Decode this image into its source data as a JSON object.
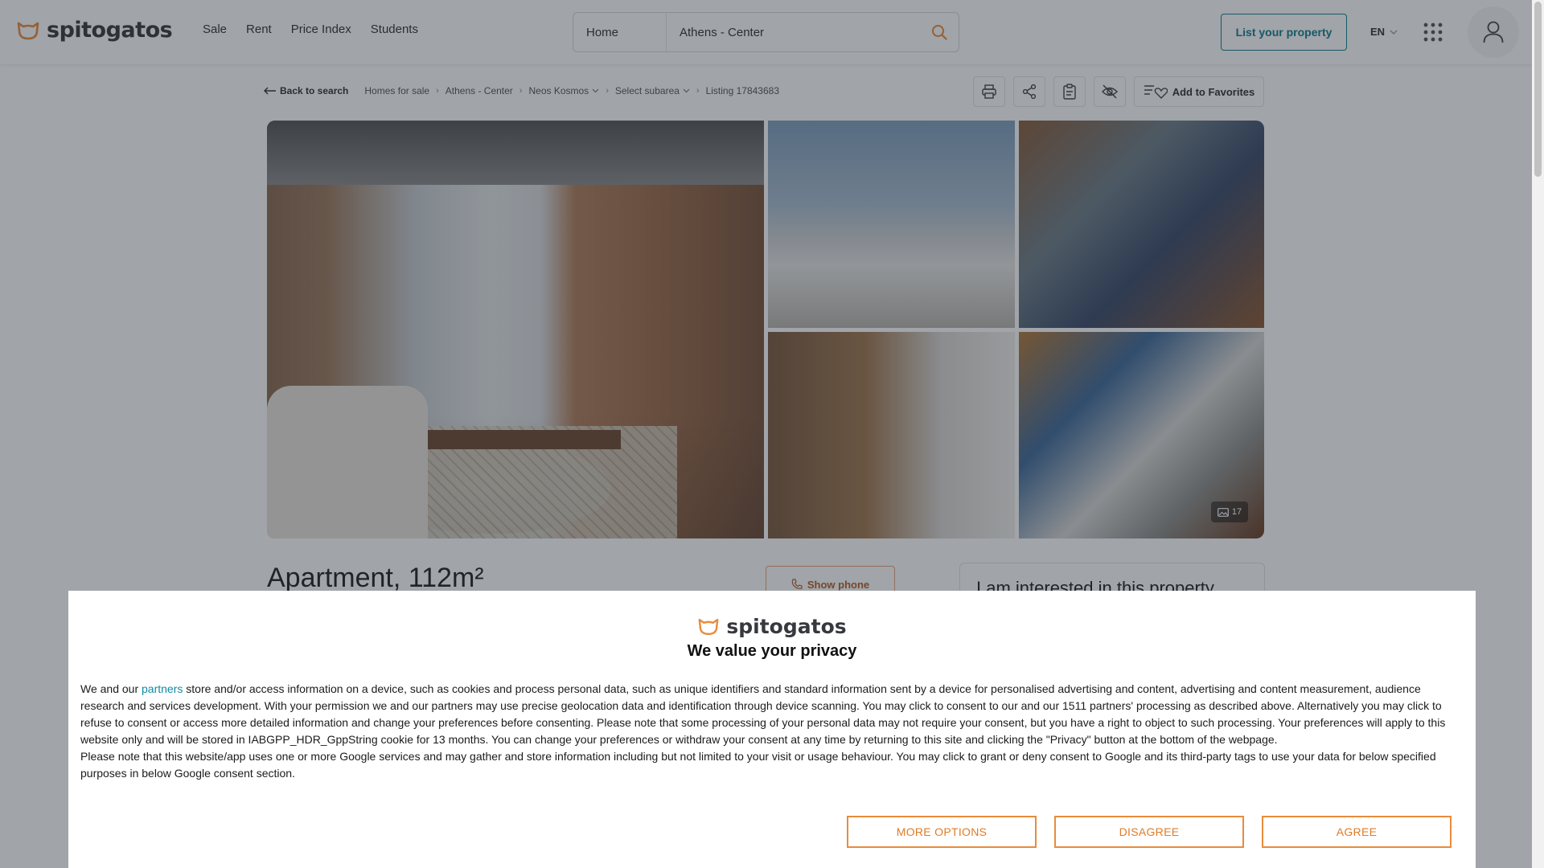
{
  "header": {
    "logo_text": "spitogatos",
    "nav": [
      "Sale",
      "Rent",
      "Price Index",
      "Students"
    ],
    "search_type": "Home",
    "search_location": "Athens - Center",
    "list_property_label": "List your property",
    "language": "EN"
  },
  "breadcrumb": {
    "back_label": "Back to search",
    "items": [
      "Homes for sale",
      "Athens - Center",
      "Neos Kosmos",
      "Select subarea",
      "Listing 17843683"
    ]
  },
  "actions": {
    "favorites_label": "Add to Favorites"
  },
  "gallery": {
    "photo_count": "17"
  },
  "listing": {
    "title": "Apartment, 112m²",
    "show_phone_label": "Show phone",
    "contact_title": "I am interested in this property"
  },
  "consent": {
    "logo_text": "spitogatos",
    "heading": "We value your privacy",
    "intro_before_link": "We and our",
    "partners_link": "partners",
    "paragraph1_rest": "store and/or access information on a device, such as cookies and process personal data, such as unique identifiers and standard information sent by a device for personalised advertising and content, advertising and content measurement, audience research and services development. With your permission we and our partners may use precise geolocation data and identification through device scanning. You may click to consent to our and our 1511 partners' processing as described above. Alternatively you may click to refuse to consent or access more detailed information and change your preferences before consenting. Please note that some processing of your personal data may not require your consent, but you have a right to object to such processing. Your preferences will apply to this website only and will be stored in IABGPP_HDR_GppString cookie for 13 months. You can change your preferences or withdraw your consent at any time by returning to this site and clicking the \"Privacy\" button at the bottom of the webpage.",
    "paragraph2": "Please note that this website/app uses one or more Google services and may gather and store information including but not limited to your visit or usage behaviour. You may click to grant or deny consent to Google and its third-party tags to use your data for below specified purposes in below Google consent section.",
    "buttons": {
      "more_options": "MORE OPTIONS",
      "disagree": "DISAGREE",
      "agree": "AGREE"
    }
  },
  "colors": {
    "brand_orange": "#e88c3c",
    "teal": "#0f7f92",
    "link": "#0e8aa3"
  }
}
